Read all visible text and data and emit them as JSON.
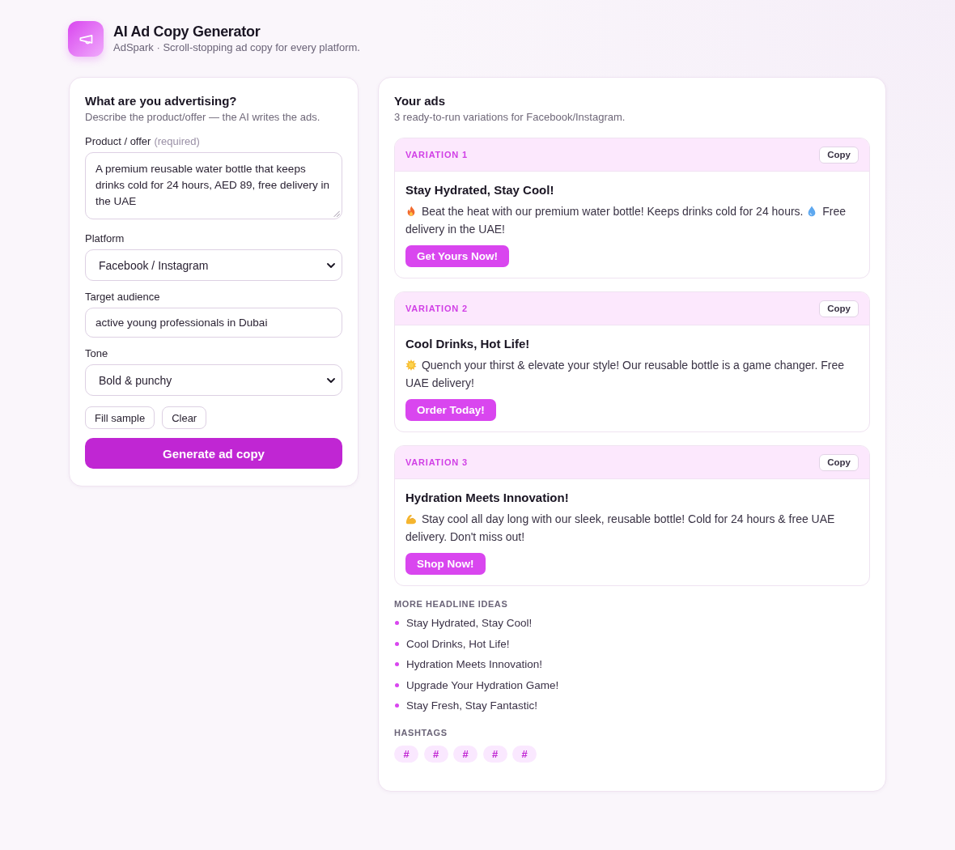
{
  "header": {
    "title": "AI Ad Copy Generator",
    "subtitle": "AdSpark · Scroll-stopping ad copy for every platform."
  },
  "form": {
    "title": "What are you advertising?",
    "subtitle": "Describe the product/offer — the AI writes the ads.",
    "fields": [
      {
        "kind": "textarea",
        "label": "Product / offer",
        "hint": "(required)",
        "value": "A premium reusable water bottle that keeps drinks cold for 24 hours, AED 89, free delivery in the UAE"
      },
      {
        "kind": "select",
        "label": "Platform",
        "value": "Facebook / Instagram"
      },
      {
        "kind": "input",
        "label": "Target audience",
        "value": "active young professionals in Dubai"
      },
      {
        "kind": "select",
        "label": "Tone",
        "value": "Bold & punchy"
      }
    ],
    "buttons": [
      "Fill sample",
      "Clear"
    ],
    "submit": "Generate ad copy"
  },
  "results": {
    "title": "Your ads",
    "subtitle": "3 ready-to-run variations for Facebook/Instagram.",
    "variations": [
      {
        "label": "VARIATION 1",
        "copy": "Copy",
        "headline": "Stay Hydrated, Stay Cool!",
        "body": [
          {
            "kind": "flame"
          },
          {
            "kind": "text",
            "text": "Beat the heat with our premium water bottle! Keeps drinks cold for 24 hours."
          },
          {
            "kind": "droplet"
          },
          {
            "kind": "text",
            "text": "Free delivery in the UAE!"
          }
        ],
        "cta": "Get Yours Now!"
      },
      {
        "label": "VARIATION 2",
        "copy": "Copy",
        "headline": "Cool Drinks, Hot Life!",
        "body": [
          {
            "kind": "sun"
          },
          {
            "kind": "text",
            "text": "Quench your thirst & elevate your style! Our reusable bottle is a game changer. Free UAE delivery!"
          }
        ],
        "cta": "Order Today!"
      },
      {
        "label": "VARIATION 3",
        "copy": "Copy",
        "headline": "Hydration Meets Innovation!",
        "body": [
          {
            "kind": "muscle"
          },
          {
            "kind": "text",
            "text": "Stay cool all day long with our sleek, reusable bottle! Cold for 24 hours & free UAE delivery. Don't miss out!"
          }
        ],
        "cta": "Shop Now!"
      }
    ],
    "more_headlines": {
      "title": "MORE HEADLINE IDEAS",
      "items": [
        "Stay Hydrated, Stay Cool!",
        "Cool Drinks, Hot Life!",
        "Hydration Meets Innovation!",
        "Upgrade Your Hydration Game!",
        "Stay Fresh, Stay Fantastic!"
      ]
    },
    "hashtags": {
      "title": "HASHTAGS",
      "items": [
        "#",
        "#",
        "#",
        "#",
        "#"
      ]
    }
  }
}
